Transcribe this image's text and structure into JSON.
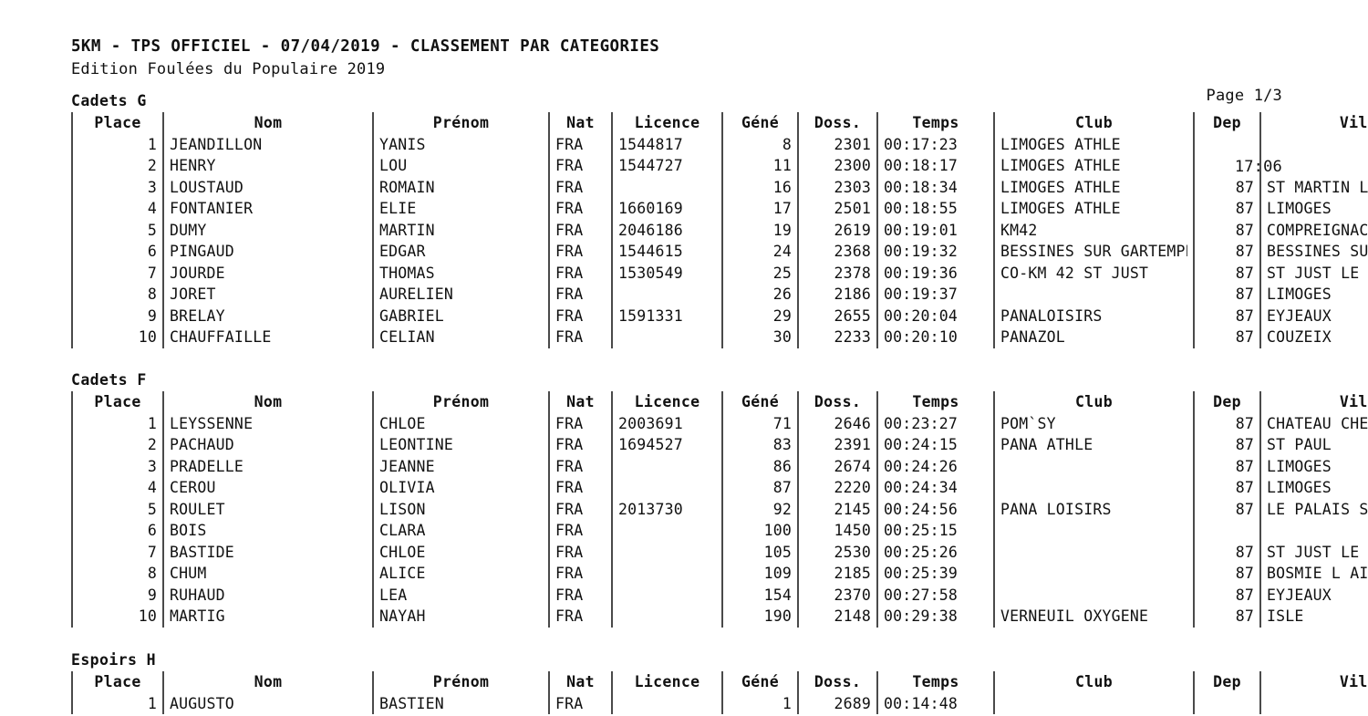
{
  "header": {
    "title": "5KM - TPS OFFICIEL - 07/04/2019 - CLASSEMENT PAR CATEGORIES",
    "subtitle": "Edition Foulées du Populaire 2019",
    "page_label": "Page 1/3",
    "time": "17:06"
  },
  "columns": {
    "place": "Place",
    "nom": "Nom",
    "prenom": "Prénom",
    "nat": "Nat",
    "licence": "Licence",
    "gene": "Géné",
    "doss": "Doss.",
    "temps": "Temps",
    "club": "Club",
    "dep": "Dep",
    "ville": "Ville"
  },
  "sections": [
    {
      "title": "Cadets G",
      "rows": [
        {
          "place": "1",
          "nom": "JEANDILLON",
          "prenom": "YANIS",
          "nat": "FRA",
          "licence": "1544817",
          "gene": "8",
          "doss": "2301",
          "temps": "00:17:23",
          "club": "LIMOGES ATHLE",
          "dep": "",
          "ville": ""
        },
        {
          "place": "2",
          "nom": "HENRY",
          "prenom": "LOU",
          "nat": "FRA",
          "licence": "1544727",
          "gene": "11",
          "doss": "2300",
          "temps": "00:18:17",
          "club": "LIMOGES ATHLE",
          "dep": "",
          "ville": ""
        },
        {
          "place": "3",
          "nom": "LOUSTAUD",
          "prenom": "ROMAIN",
          "nat": "FRA",
          "licence": "",
          "gene": "16",
          "doss": "2303",
          "temps": "00:18:34",
          "club": "LIMOGES ATHLE",
          "dep": "87",
          "ville": "ST MARTIN LE VIEUX"
        },
        {
          "place": "4",
          "nom": "FONTANIER",
          "prenom": "ELIE",
          "nat": "FRA",
          "licence": "1660169",
          "gene": "17",
          "doss": "2501",
          "temps": "00:18:55",
          "club": "LIMOGES ATHLE",
          "dep": "87",
          "ville": "LIMOGES"
        },
        {
          "place": "5",
          "nom": "DUMY",
          "prenom": "MARTIN",
          "nat": "FRA",
          "licence": "2046186",
          "gene": "19",
          "doss": "2619",
          "temps": "00:19:01",
          "club": "KM42",
          "dep": "87",
          "ville": "COMPREIGNAC"
        },
        {
          "place": "6",
          "nom": "PINGAUD",
          "prenom": "EDGAR",
          "nat": "FRA",
          "licence": "1544615",
          "gene": "24",
          "doss": "2368",
          "temps": "00:19:32",
          "club": "BESSINES SUR GARTEMPE",
          "dep": "87",
          "ville": "BESSINES SUR GARTEMPE"
        },
        {
          "place": "7",
          "nom": "JOURDE",
          "prenom": "THOMAS",
          "nat": "FRA",
          "licence": "1530549",
          "gene": "25",
          "doss": "2378",
          "temps": "00:19:36",
          "club": "CO-KM 42 ST JUST",
          "dep": "87",
          "ville": "ST JUST LE MARTEL"
        },
        {
          "place": "8",
          "nom": "JORET",
          "prenom": "AURELIEN",
          "nat": "FRA",
          "licence": "",
          "gene": "26",
          "doss": "2186",
          "temps": "00:19:37",
          "club": "",
          "dep": "87",
          "ville": "LIMOGES"
        },
        {
          "place": "9",
          "nom": "BRELAY",
          "prenom": "GABRIEL",
          "nat": "FRA",
          "licence": "1591331",
          "gene": "29",
          "doss": "2655",
          "temps": "00:20:04",
          "club": "PANALOISIRS",
          "dep": "87",
          "ville": "EYJEAUX"
        },
        {
          "place": "10",
          "nom": "CHAUFFAILLE",
          "prenom": "CELIAN",
          "nat": "FRA",
          "licence": "",
          "gene": "30",
          "doss": "2233",
          "temps": "00:20:10",
          "club": "PANAZOL",
          "dep": "87",
          "ville": "COUZEIX"
        }
      ]
    },
    {
      "title": "Cadets F",
      "rows": [
        {
          "place": "1",
          "nom": "LEYSSENNE",
          "prenom": "CHLOE",
          "nat": "FRA",
          "licence": "2003691",
          "gene": "71",
          "doss": "2646",
          "temps": "00:23:27",
          "club": "POM`SY",
          "dep": "87",
          "ville": "CHATEAU CHERVIX"
        },
        {
          "place": "2",
          "nom": "PACHAUD",
          "prenom": "LEONTINE",
          "nat": "FRA",
          "licence": "1694527",
          "gene": "83",
          "doss": "2391",
          "temps": "00:24:15",
          "club": "PANA ATHLE",
          "dep": "87",
          "ville": "ST PAUL"
        },
        {
          "place": "3",
          "nom": "PRADELLE",
          "prenom": "JEANNE",
          "nat": "FRA",
          "licence": "",
          "gene": "86",
          "doss": "2674",
          "temps": "00:24:26",
          "club": "",
          "dep": "87",
          "ville": "LIMOGES"
        },
        {
          "place": "4",
          "nom": "CEROU",
          "prenom": "OLIVIA",
          "nat": "FRA",
          "licence": "",
          "gene": "87",
          "doss": "2220",
          "temps": "00:24:34",
          "club": "",
          "dep": "87",
          "ville": "LIMOGES"
        },
        {
          "place": "5",
          "nom": "ROULET",
          "prenom": "LISON",
          "nat": "FRA",
          "licence": "2013730",
          "gene": "92",
          "doss": "2145",
          "temps": "00:24:56",
          "club": "PANA LOISIRS",
          "dep": "87",
          "ville": "LE PALAIS SUR VIENNE"
        },
        {
          "place": "6",
          "nom": "BOIS",
          "prenom": "CLARA",
          "nat": "FRA",
          "licence": "",
          "gene": "100",
          "doss": "1450",
          "temps": "00:25:15",
          "club": "",
          "dep": "",
          "ville": ""
        },
        {
          "place": "7",
          "nom": "BASTIDE",
          "prenom": "CHLOE",
          "nat": "FRA",
          "licence": "",
          "gene": "105",
          "doss": "2530",
          "temps": "00:25:26",
          "club": "",
          "dep": "87",
          "ville": "ST JUST LE MARTEL"
        },
        {
          "place": "8",
          "nom": "CHUM",
          "prenom": "ALICE",
          "nat": "FRA",
          "licence": "",
          "gene": "109",
          "doss": "2185",
          "temps": "00:25:39",
          "club": "",
          "dep": "87",
          "ville": "BOSMIE L AIGUILLE"
        },
        {
          "place": "9",
          "nom": "RUHAUD",
          "prenom": "LEA",
          "nat": "FRA",
          "licence": "",
          "gene": "154",
          "doss": "2370",
          "temps": "00:27:58",
          "club": "",
          "dep": "87",
          "ville": "EYJEAUX"
        },
        {
          "place": "10",
          "nom": "MARTIG",
          "prenom": "NAYAH",
          "nat": "FRA",
          "licence": "",
          "gene": "190",
          "doss": "2148",
          "temps": "00:29:38",
          "club": "VERNEUIL OXYGENE",
          "dep": "87",
          "ville": "ISLE"
        }
      ]
    },
    {
      "title": "Espoirs H",
      "rows": [
        {
          "place": "1",
          "nom": "AUGUSTO",
          "prenom": "BASTIEN",
          "nat": "FRA",
          "licence": "",
          "gene": "1",
          "doss": "2689",
          "temps": "00:14:48",
          "club": "",
          "dep": "",
          "ville": ""
        }
      ]
    }
  ]
}
